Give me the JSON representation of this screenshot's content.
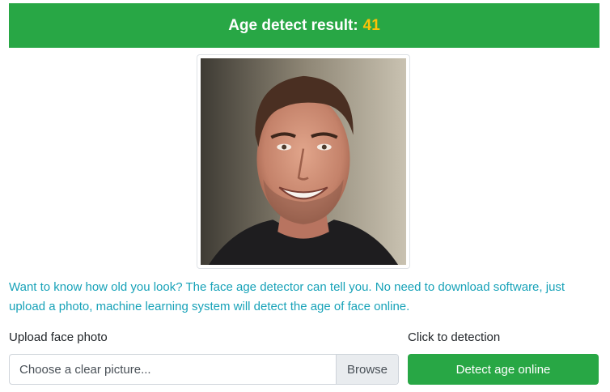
{
  "result": {
    "label": "Age detect result:",
    "age": "41"
  },
  "photo": {
    "description": "portrait photo of a smiling man"
  },
  "info": {
    "text": "Want to know how old you look? The face age detector can tell you. No need to download software, just upload a photo, machine learning system will detect the age of face online."
  },
  "upload": {
    "label": "Upload face photo",
    "placeholder": "Choose a clear picture...",
    "browse_label": "Browse"
  },
  "detect": {
    "label": "Click to detection",
    "button_label": "Detect age online"
  },
  "colors": {
    "banner": "#28a745",
    "age_highlight": "#ffc107",
    "info_text": "#17a2b8"
  }
}
